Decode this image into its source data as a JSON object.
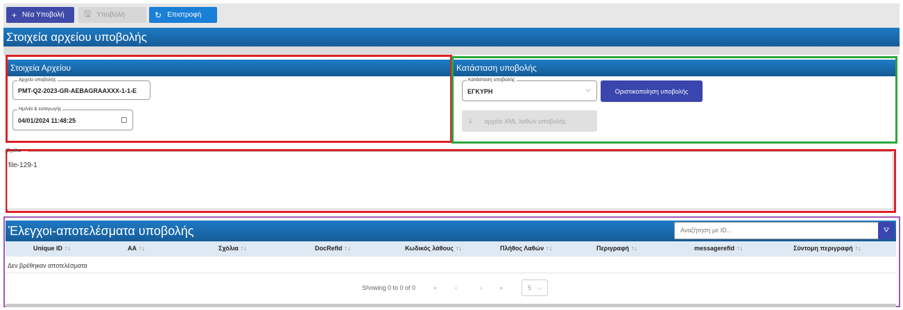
{
  "toolbar": {
    "new_label": "Νέα Υποβολή",
    "submit_label": "Υποβολή",
    "back_label": "Επιστροφή"
  },
  "page_title": "Στοιχεία αρχείου υποβολής",
  "file_panel": {
    "title": "Στοιχεία Αρχείου",
    "file_legend": "Αρχείο υποβολής",
    "file_value": "PMT-Q2-2023-GR-AEBAGRAAXXX-1-1-E",
    "date_legend": "Ημ/νία & εισαγωγής",
    "date_value": "04/01/2024 11:48:25"
  },
  "status_panel": {
    "title": "Κατάσταση υποβολής",
    "status_legend": "Κατάσταση υποβολής",
    "status_value": "ΕΓΚΥΡΗ",
    "finalize_label": "Οριστικοποίηση υποβολής",
    "xml_errors_label": "αρχείο XML λαθών υποβολής"
  },
  "comments": {
    "legend": "Σχόλια",
    "value": "file-129-1"
  },
  "results": {
    "title": "Έλεγχοι-αποτελέσματα υποβολής",
    "search_placeholder": "Αναζήτηση με ID...",
    "columns": [
      "Unique ID",
      "AA",
      "Σχόλια",
      "DocRefId",
      "Κωδικός λάθους",
      "Πλήθος Λαθών",
      "Περιγραφή",
      "messagerefid",
      "Σύντομη περιγραφή"
    ],
    "empty_message": "Δεν βρέθηκαν αποτελέσματα",
    "pager_info": "Showing 0 to 0 of 0",
    "page_size": "5"
  },
  "colors": {
    "header_blue": "#1a6fb3",
    "primary_button": "#3a46ad",
    "back_button": "#1a7fd6",
    "annotation_red": "#e01f26",
    "annotation_green": "#2aa63a",
    "annotation_purple": "#9b59b6"
  },
  "icons": {
    "new": "plus-icon",
    "submit": "save-icon",
    "back": "refresh-icon",
    "calendar": "calendar-icon",
    "dropdown": "chevron-down-icon",
    "download": "download-icon",
    "filter": "filter-icon",
    "sort": "sort-icon"
  }
}
